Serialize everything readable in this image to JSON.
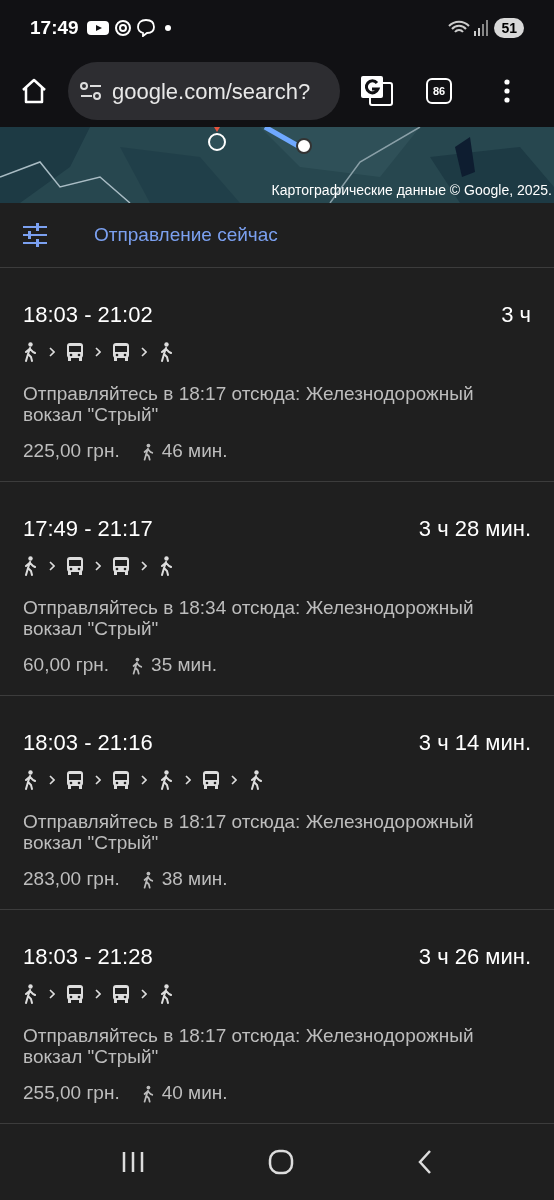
{
  "status_bar": {
    "time": "17:49",
    "battery": "51"
  },
  "browser": {
    "url": "google.com/search?",
    "tab_count": "86"
  },
  "map": {
    "attribution": "Картографические данные © Google, 2025."
  },
  "filter": {
    "label": "Отправление сейчас"
  },
  "routes": [
    {
      "times": "18:03 - 21:02",
      "duration": "3 ч",
      "segments": [
        {
          "kind": "walk"
        },
        {
          "kind": "bus"
        },
        {
          "kind": "bus"
        },
        {
          "kind": "walk"
        }
      ],
      "description": "Отправляйтесь в 18:17 отсюда: Железнодорожный вокзал \"Стрый\"",
      "price": "225,00 грн.",
      "walk_time": "46 мин."
    },
    {
      "times": "17:49 - 21:17",
      "duration": "3 ч 28 мин.",
      "segments": [
        {
          "kind": "walk"
        },
        {
          "kind": "bus"
        },
        {
          "kind": "bus"
        },
        {
          "kind": "walk"
        }
      ],
      "description": "Отправляйтесь в 18:34 отсюда: Железнодорожный вокзал \"Стрый\"",
      "price": "60,00 грн.",
      "walk_time": "35 мин."
    },
    {
      "times": "18:03 - 21:16",
      "duration": "3 ч 14 мин.",
      "segments": [
        {
          "kind": "walk"
        },
        {
          "kind": "bus"
        },
        {
          "kind": "bus"
        },
        {
          "kind": "walk"
        },
        {
          "kind": "bus"
        },
        {
          "kind": "walk"
        }
      ],
      "description": "Отправляйтесь в 18:17 отсюда: Железнодорожный вокзал \"Стрый\"",
      "price": "283,00 грн.",
      "walk_time": "38 мин."
    },
    {
      "times": "18:03 - 21:28",
      "duration": "3 ч 26 мин.",
      "segments": [
        {
          "kind": "walk"
        },
        {
          "kind": "bus"
        },
        {
          "kind": "bus"
        },
        {
          "kind": "walk"
        }
      ],
      "description": "Отправляйтесь в 18:17 отсюда: Железнодорожный вокзал \"Стрый\"",
      "price": "255,00 грн.",
      "walk_time": "40 мин."
    }
  ]
}
